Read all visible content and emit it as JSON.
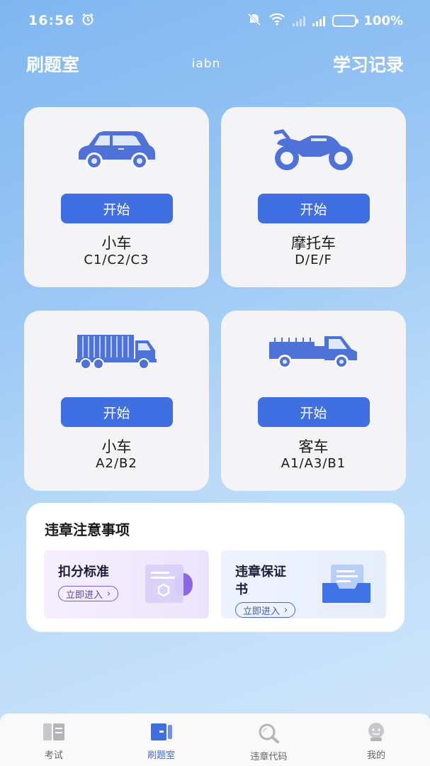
{
  "status_bar": {
    "time": "16:56",
    "battery": "100%",
    "network": "5G",
    "wifi_label": "6"
  },
  "header": {
    "title": "刷题室",
    "center_text": "iabn",
    "right_link": "学习记录"
  },
  "cards": [
    {
      "icon": "car-icon",
      "button": "开始",
      "name": "小车",
      "sub": "C1/C2/C3"
    },
    {
      "icon": "motorcycle-icon",
      "button": "开始",
      "name": "摩托车",
      "sub": "D/E/F"
    },
    {
      "icon": "truck-icon",
      "button": "开始",
      "name": "小车",
      "sub": "A2/B2"
    },
    {
      "icon": "pickup-truck-icon",
      "button": "开始",
      "name": "客车",
      "sub": "A1/A3/B1"
    }
  ],
  "notice": {
    "title": "违章注意事项",
    "items": [
      {
        "title": "扣分标准",
        "button": "立即进入"
      },
      {
        "title": "违章保证\n书",
        "title_line1": "违章保证",
        "title_line2": "书",
        "button": "立即进入"
      }
    ]
  },
  "tabbar": {
    "items": [
      {
        "label": "考试",
        "icon": "exam-icon"
      },
      {
        "label": "刷题室",
        "icon": "practice-icon",
        "active": true
      },
      {
        "label": "违章代码",
        "icon": "search-icon"
      },
      {
        "label": "我的",
        "icon": "profile-icon"
      }
    ]
  },
  "colors": {
    "accent": "#3f6fe0",
    "card_bg": "#f4f4f6",
    "background_top": "#7fb6f0",
    "background_bottom": "#cfe6fb"
  }
}
